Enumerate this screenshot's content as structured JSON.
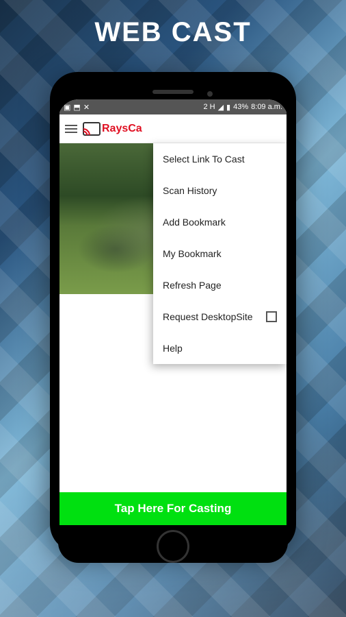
{
  "page_title": "WEB CAST",
  "status_bar": {
    "network_indicator": "2 H",
    "battery": "43%",
    "time": "8:09 a.m."
  },
  "app_header": {
    "logo_text": "RaysCa"
  },
  "menu": {
    "items": [
      {
        "label": "Select Link To Cast",
        "has_checkbox": false
      },
      {
        "label": "Scan History",
        "has_checkbox": false
      },
      {
        "label": "Add Bookmark",
        "has_checkbox": false
      },
      {
        "label": "My Bookmark",
        "has_checkbox": false
      },
      {
        "label": "Refresh Page",
        "has_checkbox": false
      },
      {
        "label": "Request DesktopSite",
        "has_checkbox": true
      },
      {
        "label": "Help",
        "has_checkbox": false
      }
    ]
  },
  "cast_button_label": "Tap Here For Casting"
}
